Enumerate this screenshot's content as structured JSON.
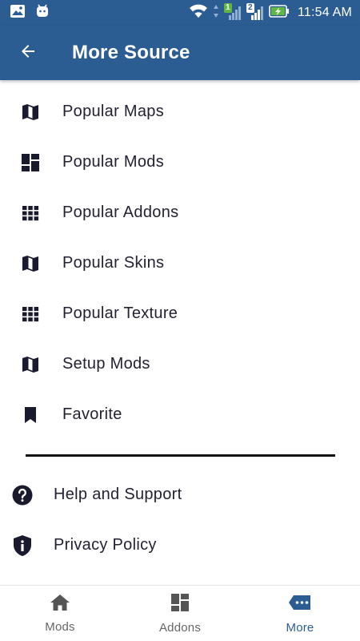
{
  "status_bar": {
    "time": "11:54 AM",
    "sim1": "1",
    "sim2": "2",
    "icons": [
      "image-icon",
      "android-icon",
      "wifi-icon",
      "signal-icon",
      "signal-icon",
      "battery-charging-icon"
    ]
  },
  "app_bar": {
    "title": "More Source",
    "back_icon": "arrow-left-icon"
  },
  "menu": {
    "items": [
      {
        "label": "Popular Maps",
        "icon": "map-icon"
      },
      {
        "label": "Popular Mods",
        "icon": "dashboard-icon"
      },
      {
        "label": "Popular Addons",
        "icon": "grid-icon"
      },
      {
        "label": "Popular Skins",
        "icon": "map-icon"
      },
      {
        "label": "Popular Texture",
        "icon": "grid-icon"
      },
      {
        "label": "Setup Mods",
        "icon": "map-icon"
      },
      {
        "label": "Favorite",
        "icon": "bookmark-icon"
      }
    ]
  },
  "support": {
    "items": [
      {
        "label": "Help and Support",
        "icon": "help-icon"
      },
      {
        "label": "Privacy Policy",
        "icon": "shield-info-icon"
      }
    ]
  },
  "bottom_nav": {
    "tabs": [
      {
        "label": "Mods",
        "icon": "home-icon",
        "active": false
      },
      {
        "label": "Addons",
        "icon": "dashboard-icon",
        "active": false
      },
      {
        "label": "More",
        "icon": "more-chat-icon",
        "active": true
      }
    ]
  },
  "colors": {
    "primary": "#2b5d93",
    "icon_dark": "#1a1a2e",
    "inactive": "#666666",
    "battery_green": "#5fb742"
  }
}
